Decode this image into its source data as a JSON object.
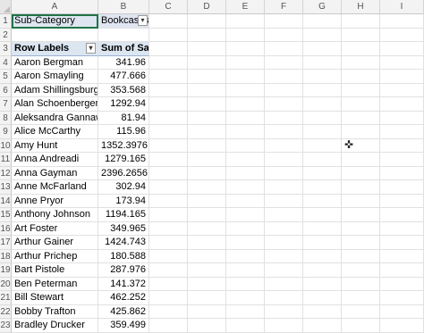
{
  "columns": [
    "A",
    "B",
    "C",
    "D",
    "E",
    "F",
    "G",
    "H",
    "I"
  ],
  "filter": {
    "field": "Sub-Category",
    "value": "Bookcases"
  },
  "pivot_header": {
    "row_labels": "Row Labels",
    "sum_label": "Sum of Sales"
  },
  "rows": [
    {
      "name": "Aaron Bergman",
      "value": "341.96"
    },
    {
      "name": "Aaron Smayling",
      "value": "477.666"
    },
    {
      "name": "Adam Shillingsburg",
      "value": "353.568"
    },
    {
      "name": "Alan Schoenberger",
      "value": "1292.94"
    },
    {
      "name": "Aleksandra Gannaway",
      "value": "81.94"
    },
    {
      "name": "Alice McCarthy",
      "value": "115.96"
    },
    {
      "name": "Amy Hunt",
      "value": "1352.3976"
    },
    {
      "name": "Anna Andreadi",
      "value": "1279.165"
    },
    {
      "name": "Anna Gayman",
      "value": "2396.2656"
    },
    {
      "name": "Anne McFarland",
      "value": "302.94"
    },
    {
      "name": "Anne Pryor",
      "value": "173.94"
    },
    {
      "name": "Anthony Johnson",
      "value": "1194.165"
    },
    {
      "name": "Art Foster",
      "value": "349.965"
    },
    {
      "name": "Arthur Gainer",
      "value": "1424.743"
    },
    {
      "name": "Arthur Prichep",
      "value": "180.588"
    },
    {
      "name": "Bart Pistole",
      "value": "287.976"
    },
    {
      "name": "Ben Peterman",
      "value": "141.372"
    },
    {
      "name": "Bill Stewart",
      "value": "462.252"
    },
    {
      "name": "Bobby Trafton",
      "value": "425.862"
    },
    {
      "name": "Bradley Drucker",
      "value": "359.499"
    }
  ],
  "row_numbers": [
    "1",
    "2",
    "3",
    "4",
    "5",
    "6",
    "7",
    "8",
    "9",
    "10",
    "11",
    "12",
    "13",
    "14",
    "15",
    "16",
    "17",
    "18",
    "19",
    "20",
    "21",
    "22",
    "23"
  ],
  "icons": {
    "filter_button": "filter-icon",
    "dropdown_button": "dropdown-arrow-icon",
    "cursor": "cross-cursor-icon"
  }
}
